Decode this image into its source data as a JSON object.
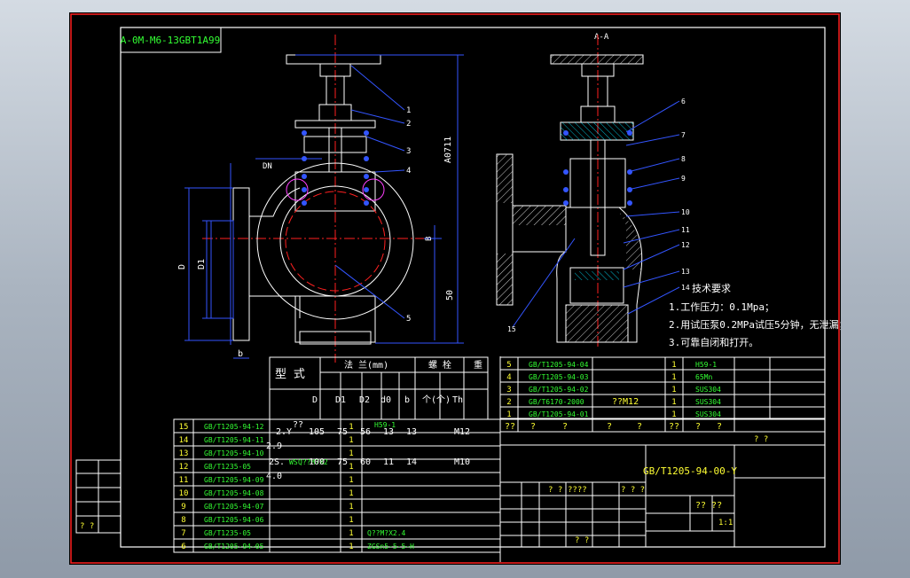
{
  "colors": {
    "background": "#000000",
    "border_red": "#ff2020",
    "line_white": "#ffffff",
    "dim_blue": "#3355ff",
    "center_red": "#ff2020",
    "hatch_cyan": "#00e5ff",
    "text_green": "#33ff33",
    "text_yellow": "#ffff33",
    "spring_magenta": "#ff40ff"
  },
  "drawing_number_box": "A-0M-M6-13GBT1A99",
  "section_label": "A-A",
  "leaders_left": [
    "1",
    "2",
    "3",
    "4",
    "5"
  ],
  "leaders_right": [
    "6",
    "7",
    "8",
    "9",
    "10",
    "11",
    "12",
    "13",
    "14",
    "15"
  ],
  "dimensions": {
    "height": "A0711",
    "top_small": "DN",
    "port": "B",
    "offset": "50",
    "d": "D",
    "d1": "D1",
    "b": "b"
  },
  "tech_requirements": {
    "title": "技术要求",
    "items": [
      "1.工作压力：0.1Mpa；",
      "2.用试压泵0.2MPa试压5分钟，无泄漏；",
      "3.可靠自闭和打开。"
    ]
  },
  "spec_table": {
    "title_model": "型 式",
    "title_flange": "法  兰(mm)",
    "title_bolt": "螺   栓",
    "title_weight": "重",
    "sub_headers": [
      "D",
      "D1",
      "D2",
      "d0",
      "b",
      "个(个)",
      "Th"
    ],
    "rows": [
      {
        "model": "2.Y",
        "q": "??",
        "D": "105",
        "D1": "75",
        "D2": "56",
        "d0": "13",
        "b": "13",
        "th": "M12",
        "note": "H59-1",
        "w": "2.9"
      },
      {
        "model": "2S.",
        "q": "WS",
        "D": "100",
        "D1": "75",
        "D2": "60",
        "d0": "11",
        "b": "14",
        "th": "M10",
        "note": "Q??M?X2",
        "w": "4.0"
      }
    ]
  },
  "bom_left": [
    {
      "no": "15",
      "code": "GB/T1205-94-12",
      "qty": "1",
      "mat": ""
    },
    {
      "no": "14",
      "code": "GB/T1205-94-11",
      "qty": "1",
      "mat": ""
    },
    {
      "no": "13",
      "code": "GB/T1205-94-10",
      "qty": "1",
      "mat": ""
    },
    {
      "no": "12",
      "code": "GB/T1235-05",
      "qty": "1",
      "mat": ""
    },
    {
      "no": "11",
      "code": "GB/T1205-94-09",
      "qty": "1",
      "mat": ""
    },
    {
      "no": "10",
      "code": "GB/T1205-94-08",
      "qty": "1",
      "mat": ""
    },
    {
      "no": "9",
      "code": "GB/T1205-94-07",
      "qty": "1",
      "mat": ""
    },
    {
      "no": "8",
      "code": "GB/T1205-94-06",
      "qty": "1",
      "mat": ""
    },
    {
      "no": "7",
      "code": "GB/T1235-05",
      "qty": "1",
      "mat": "Q??M?X2.4"
    },
    {
      "no": "6",
      "code": "GB/T1205-94-05",
      "qty": "1",
      "mat": "ZGSn5-5-5-H"
    }
  ],
  "bom_right": [
    {
      "no": "5",
      "code": "GB/T1205-94-04",
      "qty": "1",
      "mat": "H59-1"
    },
    {
      "no": "4",
      "code": "GB/T1205-94-03",
      "qty": "1",
      "mat": "65Mn"
    },
    {
      "no": "3",
      "code": "GB/T1205-94-02",
      "qty": "1",
      "mat": "SUS304"
    },
    {
      "no": "2",
      "code": "GB/T6170-2000",
      "qty": "1",
      "mat": "SUS304",
      "extra": "??M12"
    },
    {
      "no": "1",
      "code": "GB/T1205-94-01",
      "qty": "1",
      "mat": "SUS304"
    }
  ],
  "bom_header_right": [
    "??",
    "?",
    "?",
    "?",
    "?",
    "??",
    "?",
    "?"
  ],
  "bom_header_right_sub": "? ?",
  "title_block": {
    "drawing_no": "GB/T1205-94-00-Y",
    "cells": [
      "? ?",
      "????",
      "? ? ?",
      "? ?"
    ],
    "sheet": "?? ??",
    "scale": "1:1",
    "left_stamp": "? ?"
  }
}
